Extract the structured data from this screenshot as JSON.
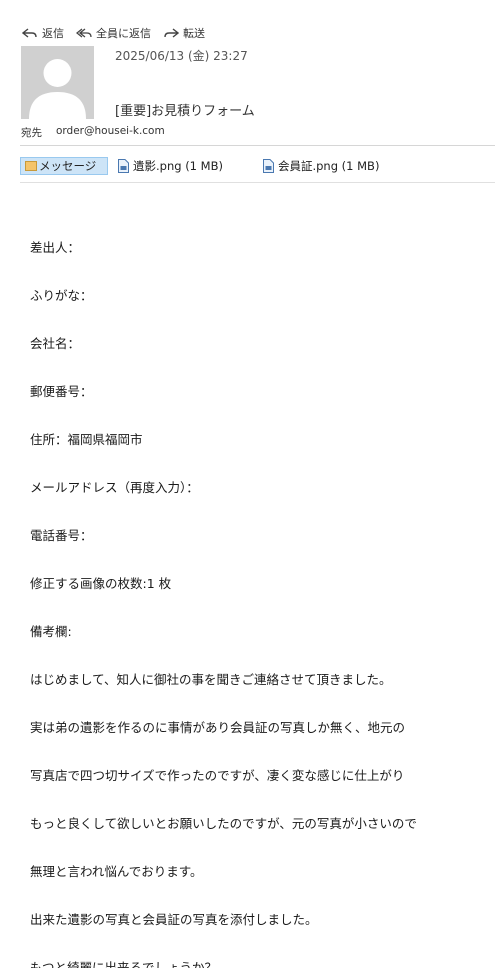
{
  "toolbar": {
    "reply_label": "返信",
    "reply_all_label": "全員に返信",
    "forward_label": "転送"
  },
  "message": {
    "date": "2025/06/13 (金) 23:27",
    "subject": "[重要]お見積りフォーム",
    "to_label": "宛先",
    "to_address": "order@housei-k.com"
  },
  "attachments": {
    "message_tab_label": "メッセージ",
    "files": [
      {
        "label": "遺影.png (1 MB)"
      },
      {
        "label": "会員証.png (1 MB)"
      }
    ]
  },
  "body_lines": [
    "差出人：",
    "ふりがな：",
    "会社名：",
    "郵便番号：",
    "住所：福岡県福岡市",
    "メールアドレス（再度入力）：",
    "電話番号：",
    "修正する画像の枚数:1 枚",
    "備考欄:",
    "はじめまして、知人に御社の事を聞きご連絡させて頂きました。",
    "実は弟の遺影を作るのに事情があり会員証の写真しか無く、地元の",
    "写真店で四つ切サイズで作ったのですが、凄く変な感じに仕上がり",
    "もっと良くして欲しいとお願いしたのですが、元の写真が小さいので",
    "無理と言われ悩んでおります。",
    "出来た遺影の写真と会員証の写真を添付しました。",
    "もつと綺麗に出来るでしょうか？"
  ],
  "icons": {
    "reply": "reply-icon",
    "reply_all": "reply-all-icon",
    "forward": "forward-icon",
    "avatar": "person-silhouette",
    "message": "envelope-icon",
    "file": "file-icon"
  },
  "colors": {
    "tab_highlight": "#cde4f7",
    "avatar_bg": "#d0d0d0"
  }
}
